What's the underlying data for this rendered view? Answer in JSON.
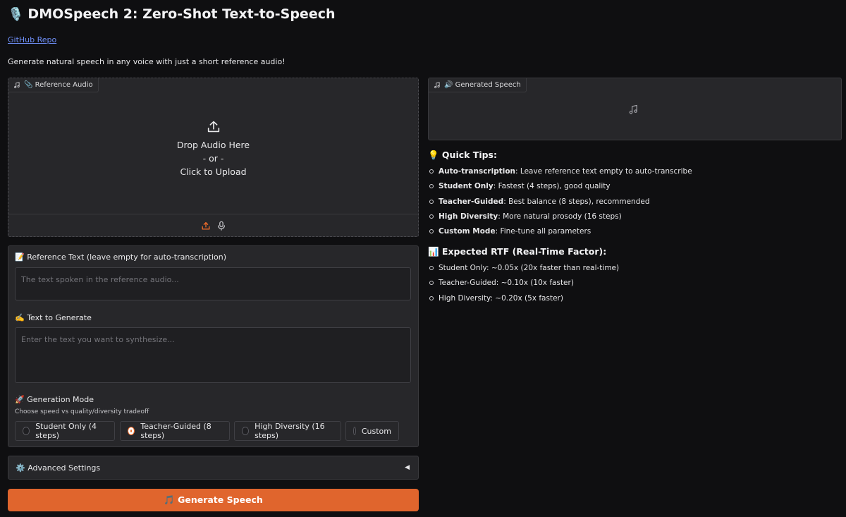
{
  "header": {
    "title": "DMOSpeech 2: Zero-Shot Text-to-Speech",
    "title_emoji": "🎙️",
    "github_link": "GitHub Repo",
    "subtitle": "Generate natural speech in any voice with just a short reference audio!"
  },
  "reference_audio": {
    "label": "📎 Reference Audio",
    "drop_text": "Drop Audio Here",
    "or_text": "- or -",
    "click_text": "Click to Upload"
  },
  "reference_text": {
    "label": "📝 Reference Text (leave empty for auto-transcription)",
    "placeholder": "The text spoken in the reference audio..."
  },
  "text_to_generate": {
    "label": "✍️ Text to Generate",
    "placeholder": "Enter the text you want to synthesize..."
  },
  "generation_mode": {
    "label": "🚀 Generation Mode",
    "hint": "Choose speed vs quality/diversity tradeoff",
    "options": [
      "Student Only (4 steps)",
      "Teacher-Guided (8 steps)",
      "High Diversity (16 steps)",
      "Custom"
    ],
    "selected": "Teacher-Guided (8 steps)"
  },
  "advanced": {
    "label": "⚙️ Advanced Settings",
    "caret": "◀"
  },
  "generate_button": {
    "label": "🎵 Generate Speech"
  },
  "generated_speech": {
    "label": "🔊 Generated Speech"
  },
  "quick_tips": {
    "title": "💡 Quick Tips:",
    "items": [
      {
        "key": "Auto-transcription",
        "text": ": Leave reference text empty to auto-transcribe"
      },
      {
        "key": "Student Only",
        "text": ": Fastest (4 steps), good quality"
      },
      {
        "key": "Teacher-Guided",
        "text": ": Best balance (8 steps), recommended"
      },
      {
        "key": "High Diversity",
        "text": ": More natural prosody (16 steps)"
      },
      {
        "key": "Custom Mode",
        "text": ": Fine-tune all parameters"
      }
    ]
  },
  "rtf": {
    "title": "📊 Expected RTF (Real-Time Factor):",
    "items": [
      "Student Only: ~0.05x (20x faster than real-time)",
      "Teacher-Guided: ~0.10x (10x faster)",
      "High Diversity: ~0.20x (5x faster)"
    ]
  },
  "colors": {
    "accent": "#e0652d",
    "link": "#6f8ff7",
    "background": "#0f0f11",
    "panel": "#27272a"
  },
  "icons": [
    "music-note-icon",
    "upload-icon",
    "microphone-icon"
  ]
}
